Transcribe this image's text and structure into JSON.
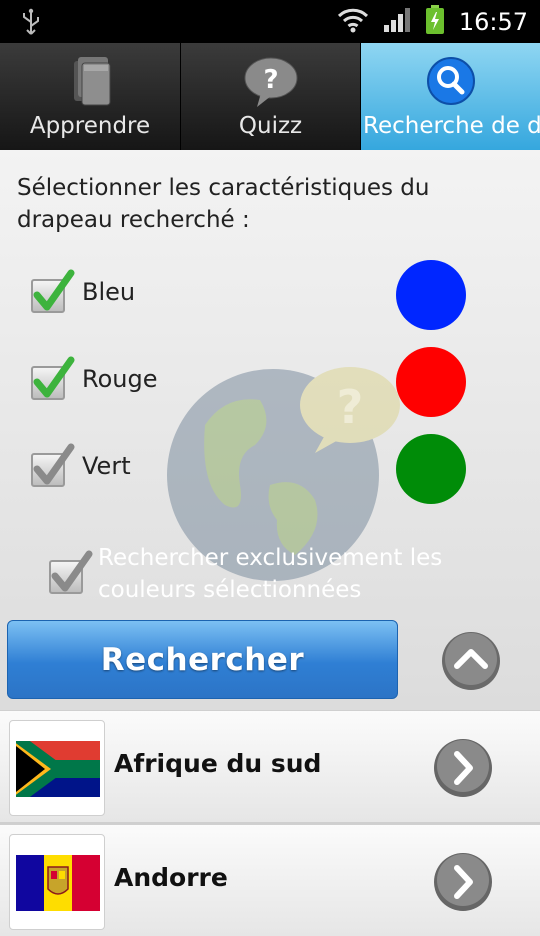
{
  "status_bar": {
    "time": "16:57"
  },
  "tabs": [
    {
      "label": "Apprendre",
      "icon": "book-stack-icon"
    },
    {
      "label": "Quizz",
      "icon": "question-bubble-icon"
    },
    {
      "label": "Recherche de drapeaux",
      "icon": "search-icon",
      "active": true
    }
  ],
  "search": {
    "prompt": "Sélectionner les caractéristiques du drapeau recherché :",
    "colors": [
      {
        "label": "Bleu",
        "checked": true,
        "swatch": "#0026ff"
      },
      {
        "label": "Rouge",
        "checked": true,
        "swatch": "#ff0000"
      },
      {
        "label": "Vert",
        "checked": true,
        "swatch": "#008c08"
      }
    ],
    "exclusive_label": "Rechercher exclusivement les couleurs sélectionnées",
    "exclusive_checked": true,
    "button_label": "Rechercher"
  },
  "results": [
    {
      "name": "Afrique du sud"
    },
    {
      "name": "Andorre"
    }
  ],
  "colors": {
    "accent": "#35a7de",
    "button": "#2f7fd4",
    "check": "#3db33d"
  }
}
